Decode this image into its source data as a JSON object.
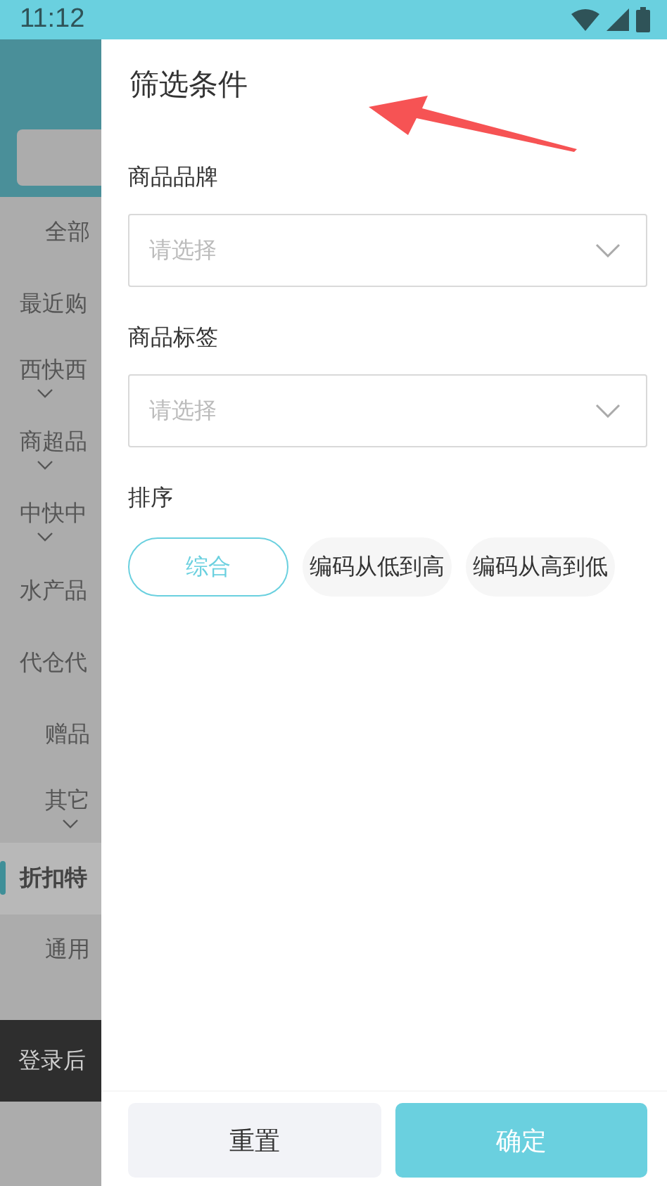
{
  "status_bar": {
    "time": "11:12"
  },
  "sidebar": {
    "items": [
      {
        "label": "全部",
        "kind": "centered",
        "has_children": false,
        "selected": false
      },
      {
        "label": "最近购",
        "kind": "truncated",
        "has_children": false,
        "selected": false
      },
      {
        "label": "西快西",
        "kind": "truncated",
        "has_children": true,
        "selected": false
      },
      {
        "label": "商超品",
        "kind": "truncated",
        "has_children": true,
        "selected": false
      },
      {
        "label": "中快中",
        "kind": "truncated",
        "has_children": true,
        "selected": false
      },
      {
        "label": "水产品",
        "kind": "truncated",
        "has_children": false,
        "selected": false
      },
      {
        "label": "代仓代",
        "kind": "truncated",
        "has_children": false,
        "selected": false
      },
      {
        "label": "赠品",
        "kind": "centered",
        "has_children": false,
        "selected": false
      },
      {
        "label": "其它",
        "kind": "centered",
        "has_children": true,
        "selected": false
      },
      {
        "label": "折扣特",
        "kind": "truncated",
        "has_children": false,
        "selected": true
      },
      {
        "label": "通用",
        "kind": "centered",
        "has_children": false,
        "selected": false
      }
    ],
    "login_banner": "登录后"
  },
  "drawer": {
    "title": "筛选条件",
    "filters": [
      {
        "label": "商品品牌",
        "placeholder": "请选择"
      },
      {
        "label": "商品标签",
        "placeholder": "请选择"
      }
    ],
    "sort": {
      "label": "排序",
      "options": [
        {
          "label": "综合",
          "selected": true
        },
        {
          "label": "编码从低到高",
          "selected": false
        },
        {
          "label": "编码从高到低",
          "selected": false
        }
      ]
    },
    "buttons": [
      {
        "label": "重置",
        "kind": "secondary"
      },
      {
        "label": "确定",
        "kind": "primary"
      }
    ]
  }
}
